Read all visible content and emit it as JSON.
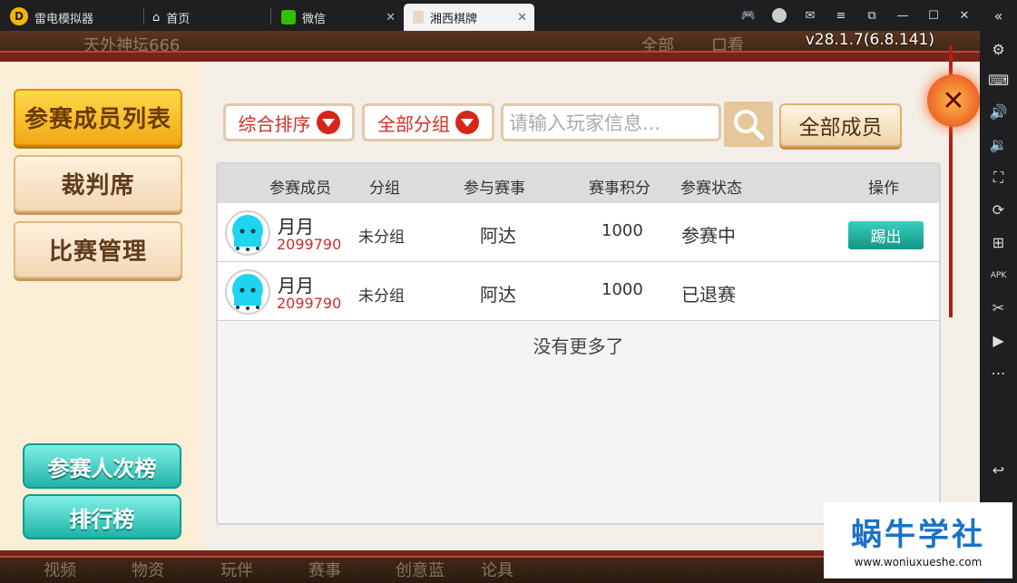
{
  "titlebar": {
    "app_name": "雷电模拟器",
    "tabs": [
      {
        "label": "首页"
      },
      {
        "label": "微信"
      },
      {
        "label": "湘西棋牌"
      }
    ]
  },
  "game": {
    "version": "v28.1.7(6.8.141)",
    "background": {
      "top_texts": [
        "天外神坛666",
        "全部",
        "口看"
      ],
      "bottom_texts": [
        "视频",
        "物资",
        "玩伴",
        "赛事",
        "创意蓝",
        "论具"
      ]
    },
    "left_menu": [
      {
        "label": "参赛成员列表"
      },
      {
        "label": "裁判席"
      },
      {
        "label": "比赛管理"
      }
    ],
    "left_bottom_buttons": [
      {
        "label": "参赛人次榜"
      },
      {
        "label": "排行榜"
      }
    ],
    "filters": {
      "sort": "综合排序",
      "group": "全部分组",
      "search_placeholder": "请输入玩家信息...",
      "all_members": "全部成员"
    },
    "table": {
      "headers": [
        "参赛成员",
        "分组",
        "参与赛事",
        "赛事积分",
        "参赛状态",
        "操作"
      ],
      "rows": [
        {
          "name": "月月",
          "id": "2099790",
          "group": "未分组",
          "event": "阿达",
          "score": "1000",
          "status": "参赛中",
          "action": "踢出"
        },
        {
          "name": "月月",
          "id": "2099790",
          "group": "未分组",
          "event": "阿达",
          "score": "1000",
          "status": "已退赛",
          "action": ""
        }
      ],
      "footer": "没有更多了"
    }
  },
  "watermark": {
    "title": "蜗牛学社",
    "url": "www.woniuxueshe.com"
  },
  "colors": {
    "accent_red": "#d5261c",
    "teal": "#1fb3a6",
    "gold": "#f1a915"
  }
}
